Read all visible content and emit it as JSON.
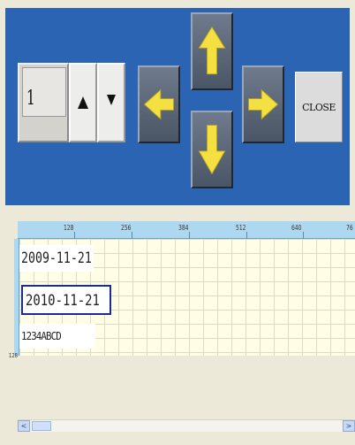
{
  "controls": {
    "number_value": "1",
    "close_label": "CLOSE"
  },
  "ruler": {
    "top_labels": [
      "128",
      "256",
      "384",
      "512",
      "640",
      "76"
    ],
    "left_labels": [
      "128"
    ]
  },
  "fields": [
    {
      "text": "2009-11-21"
    },
    {
      "text": "2010-11-21"
    },
    {
      "text": "1234ABCD"
    }
  ],
  "scrollbar": {
    "left_glyph": "<",
    "right_glyph": ">"
  },
  "icons": {
    "spin_up": "triangle-up-icon",
    "spin_down": "triangle-down-icon",
    "left": "arrow-left-icon",
    "up": "arrow-up-icon",
    "down": "arrow-down-icon",
    "right": "arrow-right-icon"
  },
  "colors": {
    "panel_bg": "#2c64b4",
    "arrow_yellow": "#f4e040",
    "canvas_bg": "#fffde4",
    "ruler_bg": "#aed8f0",
    "selection_border": "#1c2b8f"
  }
}
